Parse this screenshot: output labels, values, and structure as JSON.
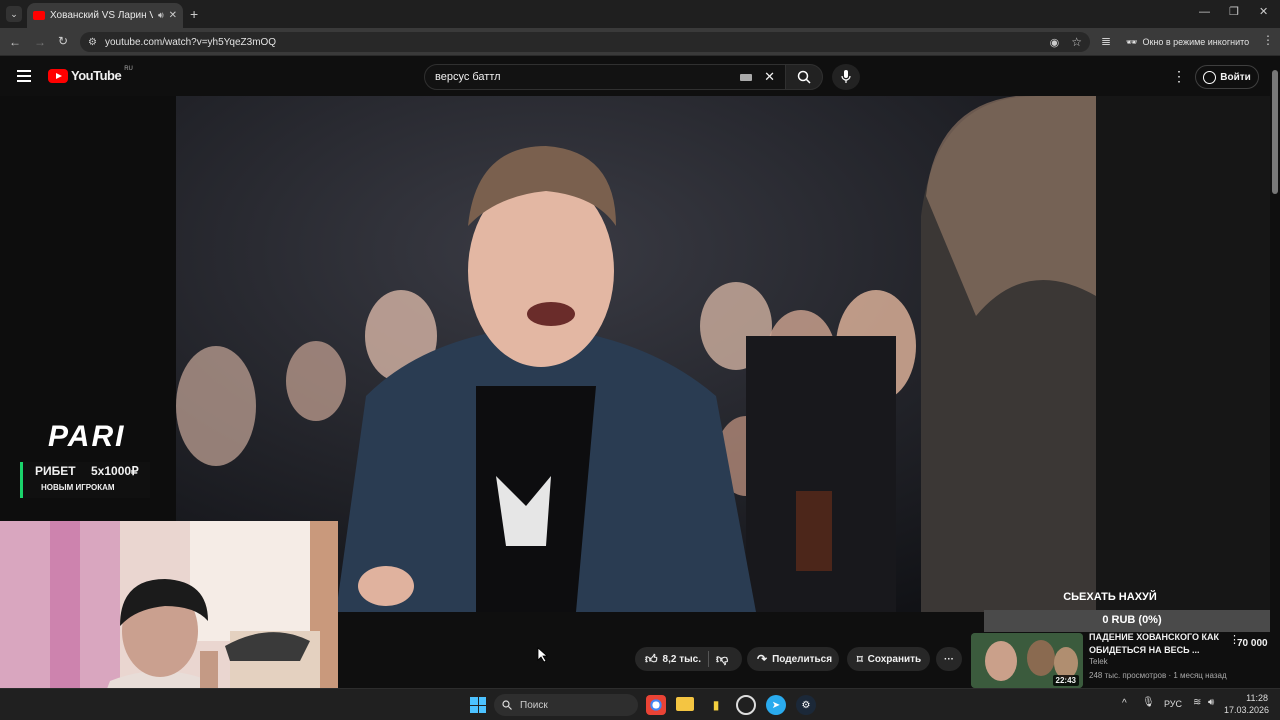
{
  "browser": {
    "tab_title": "Хованский VS Ларин Versus",
    "url": "youtube.com/watch?v=yh5YqeZ3mOQ",
    "incognito_label": "Окно в режиме инкогнито"
  },
  "youtube": {
    "logo_text": "YouTube",
    "region": "RU",
    "search_value": "версус баттл",
    "signin_label": "Войти"
  },
  "overlays": {
    "pari_logo": "PARI",
    "pari_promo_left": "РИБЕТ",
    "pari_promo_right": "5x1000₽",
    "pari_promo_sub": "НОВЫМ ИГРОКАМ",
    "donation_title": "СЬЕХАТЬ НАХУЙ",
    "donation_value": "0 RUB (0%)"
  },
  "actions": {
    "likes": "8,2 тыс.",
    "share": "Поделиться",
    "save": "Сохранить"
  },
  "related": {
    "title": "ПАДЕНИЕ ХОВАНСКОГО КАК ОБИДЕТЬСЯ НА ВЕСЬ ...",
    "channel": "Telek",
    "meta": "248 тыс. просмотров · 1 месяц назад",
    "duration": "22:43",
    "overlay_count": "70 000"
  },
  "taskbar": {
    "search_placeholder": "Поиск",
    "lang": "РУС",
    "time": "11:28",
    "date": "17.03.2026"
  },
  "colors": {
    "yt_red": "#ff0000",
    "pari_green": "#1ad36b"
  }
}
